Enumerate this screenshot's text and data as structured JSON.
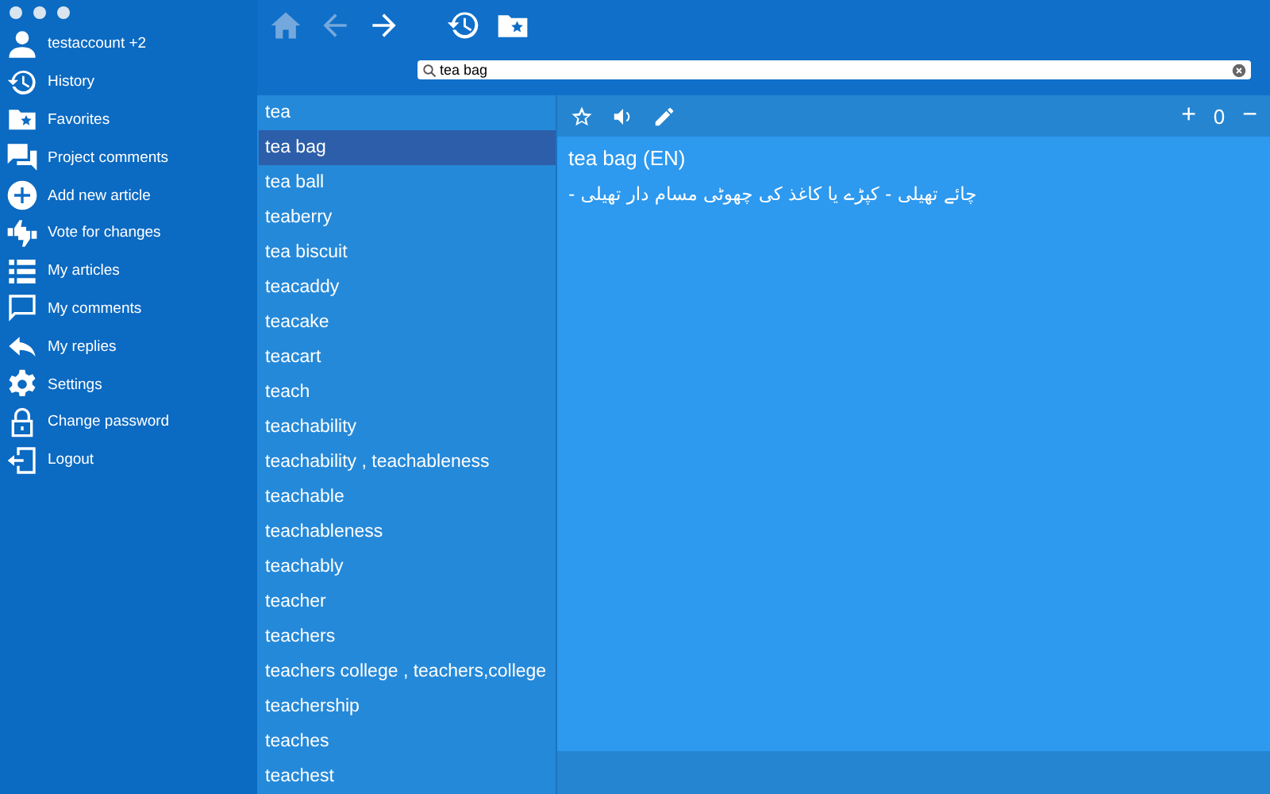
{
  "sidebar": {
    "items": [
      {
        "label": "testaccount  +2"
      },
      {
        "label": "History"
      },
      {
        "label": "Favorites"
      },
      {
        "label": "Project comments"
      },
      {
        "label": "Add new article"
      },
      {
        "label": "Vote for changes"
      },
      {
        "label": "My articles"
      },
      {
        "label": "My comments"
      },
      {
        "label": "My replies"
      },
      {
        "label": "Settings"
      },
      {
        "label": "Change password"
      },
      {
        "label": "Logout"
      }
    ]
  },
  "toolbar": [
    {
      "disabled": true
    },
    {
      "disabled": true
    },
    {
      "disabled": false
    },
    {
      "disabled": false
    },
    {
      "disabled": false
    }
  ],
  "search": {
    "value": "tea bag"
  },
  "word_list": [
    {
      "label": "tea",
      "selected": false
    },
    {
      "label": "tea bag",
      "selected": true
    },
    {
      "label": "tea ball",
      "selected": false
    },
    {
      "label": "teaberry",
      "selected": false
    },
    {
      "label": "tea biscuit",
      "selected": false
    },
    {
      "label": "teacaddy",
      "selected": false
    },
    {
      "label": "teacake",
      "selected": false
    },
    {
      "label": "teacart",
      "selected": false
    },
    {
      "label": "teach",
      "selected": false
    },
    {
      "label": "teachability",
      "selected": false
    },
    {
      "label": "teachability , teachableness",
      "selected": false
    },
    {
      "label": "teachable",
      "selected": false
    },
    {
      "label": "teachableness",
      "selected": false
    },
    {
      "label": "teachably",
      "selected": false
    },
    {
      "label": "teacher",
      "selected": false
    },
    {
      "label": "teachers",
      "selected": false
    },
    {
      "label": "teachers college , teachers,college",
      "selected": false
    },
    {
      "label": "teachership",
      "selected": false
    },
    {
      "label": "teaches",
      "selected": false
    },
    {
      "label": "teachest",
      "selected": false
    }
  ],
  "article": {
    "rating": {
      "plus": "+",
      "count": "0",
      "minus": "−"
    },
    "title": "tea bag (EN)",
    "translation": "چائے تھیلی - کپڑے یا کاغذ کی چھوٹی مسام دار تھیلی -"
  }
}
